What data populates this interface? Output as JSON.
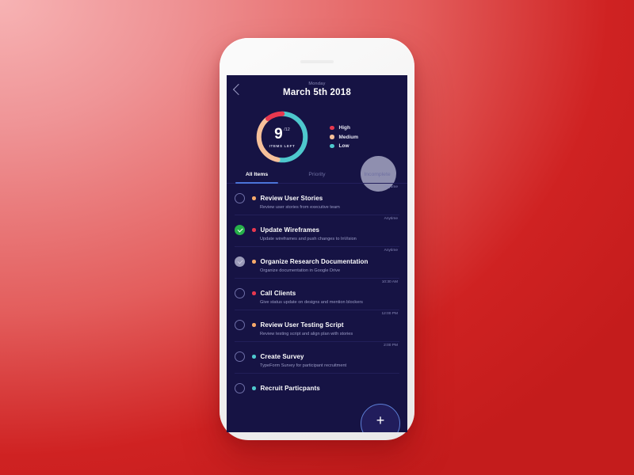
{
  "app": {
    "header": {
      "back_icon": "chevron-left-icon",
      "weekday": "Monday",
      "date": "March 5th 2018"
    },
    "summary": {
      "count": "9",
      "total": "/12",
      "caption": "ITEMS LEFT",
      "legend": [
        {
          "label": "High",
          "color": "#e8384f"
        },
        {
          "label": "Medium",
          "color": "#f6c09a"
        },
        {
          "label": "Low",
          "color": "#4ec8cd"
        }
      ]
    },
    "tabs": [
      {
        "label": "All Items",
        "active": true
      },
      {
        "label": "Priority",
        "active": false
      },
      {
        "label": "Incomplete",
        "active": false
      }
    ],
    "fab": {
      "label": "+",
      "icon": "plus-icon"
    },
    "tasks": [
      {
        "time": "Anytime",
        "title": "Review User Stories",
        "subtitle": "Review user stories from executive team",
        "priority": "Medium",
        "priority_color": "#f6a96a",
        "state": "open"
      },
      {
        "time": "Anytime",
        "title": "Update Wireframes",
        "subtitle": "Update wireframes and push changes to InVision",
        "priority": "High",
        "priority_color": "#e8384f",
        "state": "done"
      },
      {
        "time": "Anytime",
        "title": "Organize Research Documentation",
        "subtitle": "Organize documentation in Google Drive",
        "priority": "Medium",
        "priority_color": "#f6a96a",
        "state": "pending"
      },
      {
        "time": "10:30 AM",
        "title": "Call Clients",
        "subtitle": "Give status update on designs and mention blockers",
        "priority": "High",
        "priority_color": "#e8384f",
        "state": "open"
      },
      {
        "time": "12:00 PM",
        "title": "Review User Testing Script",
        "subtitle": "Review testing script and align plan with stories",
        "priority": "Medium",
        "priority_color": "#f6a96a",
        "state": "open"
      },
      {
        "time": "2:00 PM",
        "title": "Create Survey",
        "subtitle": "TypeForm Survey for participant recruitment",
        "priority": "Low",
        "priority_color": "#4ec8cd",
        "state": "open"
      },
      {
        "time": "",
        "title": "Recruit Particpants",
        "subtitle": "",
        "priority": "Low",
        "priority_color": "#4ec8cd",
        "state": "open"
      }
    ]
  },
  "chart_data": {
    "type": "pie",
    "title": "ITEMS LEFT",
    "categories": [
      "Low",
      "Medium",
      "High"
    ],
    "values": [
      52,
      36,
      12
    ],
    "colors": [
      "#4ec8cd",
      "#f6c09a",
      "#e8384f"
    ],
    "center_value": "9",
    "center_total": "/12",
    "center_label": "ITEMS LEFT",
    "legend_position": "right",
    "grid": false
  }
}
